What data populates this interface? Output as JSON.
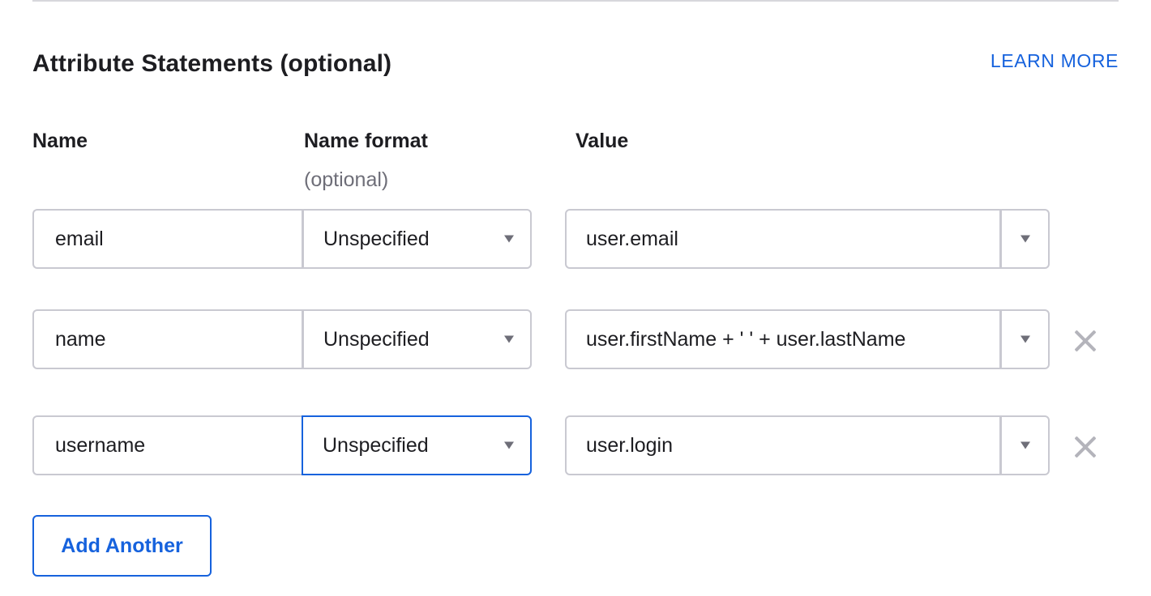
{
  "section": {
    "title": "Attribute Statements (optional)",
    "learn_more": "LEARN MORE"
  },
  "columns": {
    "name": "Name",
    "name_format": "Name format",
    "name_format_sub": "(optional)",
    "value": "Value"
  },
  "rows": [
    {
      "name": "email",
      "format": "Unspecified",
      "value": "user.email",
      "removable": false,
      "format_focused": false
    },
    {
      "name": "name",
      "format": "Unspecified",
      "value": "user.firstName + ' ' + user.lastName",
      "removable": true,
      "format_focused": false
    },
    {
      "name": "username",
      "format": "Unspecified",
      "value": "user.login",
      "removable": true,
      "format_focused": true
    }
  ],
  "actions": {
    "add_another": "Add Another"
  },
  "colors": {
    "accent": "#1662dd",
    "border": "#c9c9d1",
    "text": "#1d1d21",
    "muted": "#6e6e78",
    "remove_icon": "#b4b4bb"
  },
  "icons": {
    "dropdown": "caret-down-icon",
    "remove": "close-icon"
  }
}
